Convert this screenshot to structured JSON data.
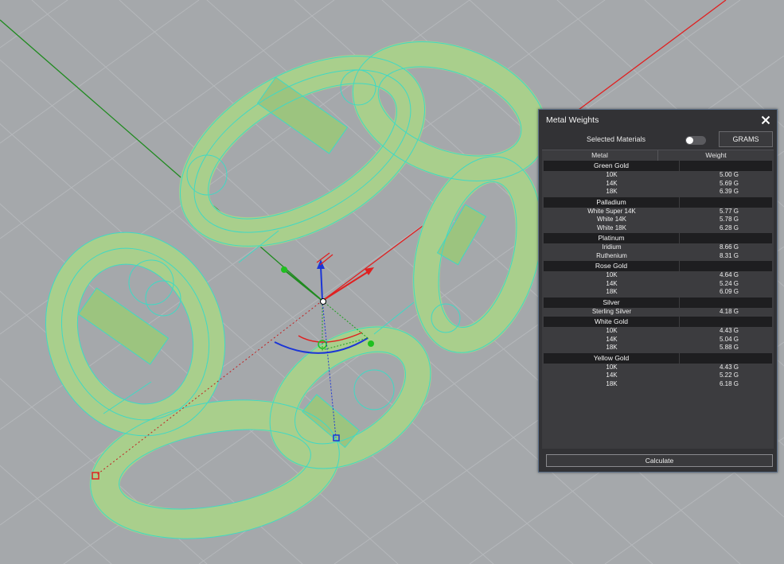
{
  "panel": {
    "title": "Metal Weights",
    "selected_materials_label": "Selected Materials",
    "units_button": "GRAMS",
    "columns": [
      "Metal",
      "Weight"
    ],
    "groups": [
      {
        "name": "Green Gold",
        "items": [
          {
            "metal": "10K",
            "weight": "5.00 G"
          },
          {
            "metal": "14K",
            "weight": "5.69 G"
          },
          {
            "metal": "18K",
            "weight": "6.39 G"
          }
        ]
      },
      {
        "name": "Palladium",
        "items": [
          {
            "metal": "White Super 14K",
            "weight": "5.77 G"
          },
          {
            "metal": "White 14K",
            "weight": "5.78 G"
          },
          {
            "metal": "White 18K",
            "weight": "6.28 G"
          }
        ]
      },
      {
        "name": "Platinum",
        "items": [
          {
            "metal": "Iridium",
            "weight": "8.66 G"
          },
          {
            "metal": "Ruthenium",
            "weight": "8.31 G"
          }
        ]
      },
      {
        "name": "Rose Gold",
        "items": [
          {
            "metal": "10K",
            "weight": "4.64 G"
          },
          {
            "metal": "14K",
            "weight": "5.24 G"
          },
          {
            "metal": "18K",
            "weight": "6.09 G"
          }
        ]
      },
      {
        "name": "Silver",
        "items": [
          {
            "metal": "Sterling Silver",
            "weight": "4.18 G"
          }
        ]
      },
      {
        "name": "White Gold",
        "items": [
          {
            "metal": "10K",
            "weight": "4.43 G"
          },
          {
            "metal": "14K",
            "weight": "5.04 G"
          },
          {
            "metal": "18K",
            "weight": "5.88 G"
          }
        ]
      },
      {
        "name": "Yellow Gold",
        "items": [
          {
            "metal": "10K",
            "weight": "4.43 G"
          },
          {
            "metal": "14K",
            "weight": "5.22 G"
          },
          {
            "metal": "18K",
            "weight": "6.18 G"
          }
        ]
      }
    ],
    "calculate_button": "Calculate"
  },
  "colors": {
    "viewport_bg": "#a5a8ab",
    "grid_line": "#b4b7ba",
    "model_fill": "#a9cf8c",
    "model_wire": "#40d9c4",
    "x_axis": "#e02020",
    "y_axis": "#1f8a1f",
    "z_axis": "#1b35d6",
    "panel_bg": "#323235",
    "panel_border": "#5a6d86"
  },
  "icons": {
    "close": "close-icon"
  }
}
